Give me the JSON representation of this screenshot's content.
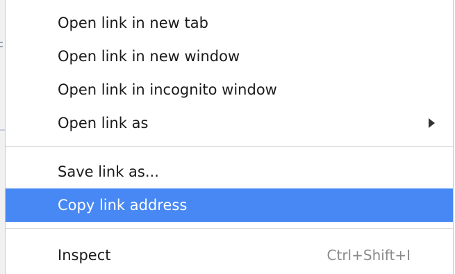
{
  "context_menu": {
    "items": [
      {
        "label": "Open link in new tab"
      },
      {
        "label": "Open link in new window"
      },
      {
        "label": "Open link in incognito window"
      },
      {
        "label": "Open link as",
        "submenu_icon": "chevron-right-icon"
      },
      {
        "label": "Save link as..."
      },
      {
        "label": "Copy link address",
        "state": "highlighted"
      },
      {
        "label": "Inspect",
        "shortcut": "Ctrl+Shift+I"
      }
    ]
  },
  "colors": {
    "highlight": "#4788f4",
    "text": "#1a1a1a",
    "shortcut_text": "#8a8a8a",
    "separator": "#dcdcdc"
  }
}
